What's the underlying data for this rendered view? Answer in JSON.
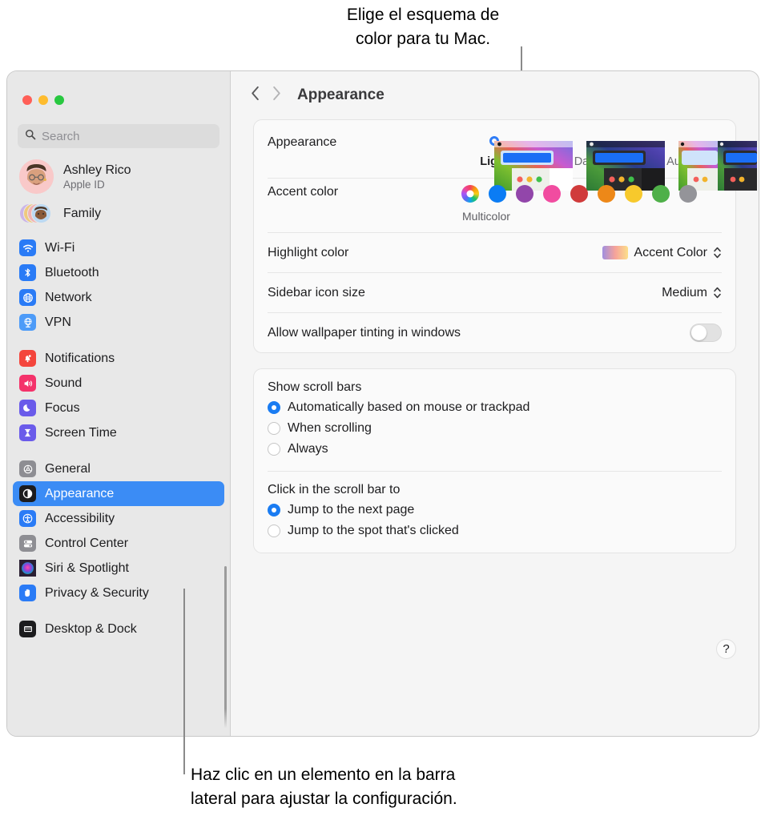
{
  "callouts": {
    "top": "Elige el esquema de\ncolor para tu Mac.",
    "bottom": "Haz clic en un elemento en la barra\nlateral para ajustar la configuración."
  },
  "window": {
    "traffic_lights": [
      "close",
      "minimize",
      "zoom"
    ]
  },
  "sidebar": {
    "search": {
      "placeholder": "Search",
      "value": ""
    },
    "account": {
      "name": "Ashley Rico",
      "subtitle": "Apple ID"
    },
    "family": {
      "label": "Family"
    },
    "groups": [
      {
        "items": [
          {
            "label": "Wi-Fi",
            "icon": "wifi-icon",
            "color": "#2a7bf6",
            "selected": false
          },
          {
            "label": "Bluetooth",
            "icon": "bluetooth-icon",
            "color": "#2a7bf6",
            "selected": false
          },
          {
            "label": "Network",
            "icon": "globe-icon",
            "color": "#2a7bf6",
            "selected": false
          },
          {
            "label": "VPN",
            "icon": "vpn-icon",
            "color": "#4d9bf8",
            "selected": false
          }
        ]
      },
      {
        "items": [
          {
            "label": "Notifications",
            "icon": "bell-icon",
            "color": "#f4453c",
            "selected": false
          },
          {
            "label": "Sound",
            "icon": "speaker-icon",
            "color": "#f4326a",
            "selected": false
          },
          {
            "label": "Focus",
            "icon": "moon-icon",
            "color": "#6a5bea",
            "selected": false
          },
          {
            "label": "Screen Time",
            "icon": "hourglass-icon",
            "color": "#6a5bea",
            "selected": false
          }
        ]
      },
      {
        "items": [
          {
            "label": "General",
            "icon": "gear-icon",
            "color": "#8e8e93",
            "selected": false
          },
          {
            "label": "Appearance",
            "icon": "appearance-icon",
            "color": "#1c1c1e",
            "selected": true
          },
          {
            "label": "Accessibility",
            "icon": "accessibility-icon",
            "color": "#2a7bf6",
            "selected": false
          },
          {
            "label": "Control Center",
            "icon": "control-center-icon",
            "color": "#8e8e93",
            "selected": false
          },
          {
            "label": "Siri & Spotlight",
            "icon": "siri-icon",
            "color": "#3a2a4a",
            "selected": false
          },
          {
            "label": "Privacy & Security",
            "icon": "hand-icon",
            "color": "#2a7bf6",
            "selected": false
          }
        ]
      },
      {
        "items": [
          {
            "label": "Desktop & Dock",
            "icon": "desktop-icon",
            "color": "#1c1c1e",
            "selected": false
          }
        ]
      }
    ]
  },
  "toolbar": {
    "back": "back",
    "forward": "forward",
    "title": "Appearance"
  },
  "main": {
    "appearance": {
      "label": "Appearance",
      "options": [
        {
          "label": "Light",
          "selected": true
        },
        {
          "label": "Dark",
          "selected": false
        },
        {
          "label": "Auto",
          "selected": false
        }
      ]
    },
    "accent": {
      "label": "Accent color",
      "selected_name": "Multicolor",
      "swatches": [
        {
          "name": "Multicolor",
          "color": "multicolor",
          "selected": true
        },
        {
          "name": "Blue",
          "color": "#0b7cf4",
          "selected": false
        },
        {
          "name": "Purple",
          "color": "#9246aa",
          "selected": false
        },
        {
          "name": "Pink",
          "color": "#f14ca0",
          "selected": false
        },
        {
          "name": "Red",
          "color": "#d03b3b",
          "selected": false
        },
        {
          "name": "Orange",
          "color": "#ed8818",
          "selected": false
        },
        {
          "name": "Yellow",
          "color": "#f7c92c",
          "selected": false
        },
        {
          "name": "Green",
          "color": "#4fb049",
          "selected": false
        },
        {
          "name": "Graphite",
          "color": "#949499",
          "selected": false
        }
      ]
    },
    "highlight": {
      "label": "Highlight color",
      "value": "Accent Color"
    },
    "sidebar_icon_size": {
      "label": "Sidebar icon size",
      "value": "Medium"
    },
    "wallpaper_tinting": {
      "label": "Allow wallpaper tinting in windows",
      "enabled": false
    },
    "scroll_bars": {
      "title": "Show scroll bars",
      "options": [
        {
          "label": "Automatically based on mouse or trackpad",
          "selected": true
        },
        {
          "label": "When scrolling",
          "selected": false
        },
        {
          "label": "Always",
          "selected": false
        }
      ]
    },
    "scroll_click": {
      "title": "Click in the scroll bar to",
      "options": [
        {
          "label": "Jump to the next page",
          "selected": true
        },
        {
          "label": "Jump to the spot that's clicked",
          "selected": false
        }
      ]
    },
    "help": {
      "label": "?"
    }
  }
}
